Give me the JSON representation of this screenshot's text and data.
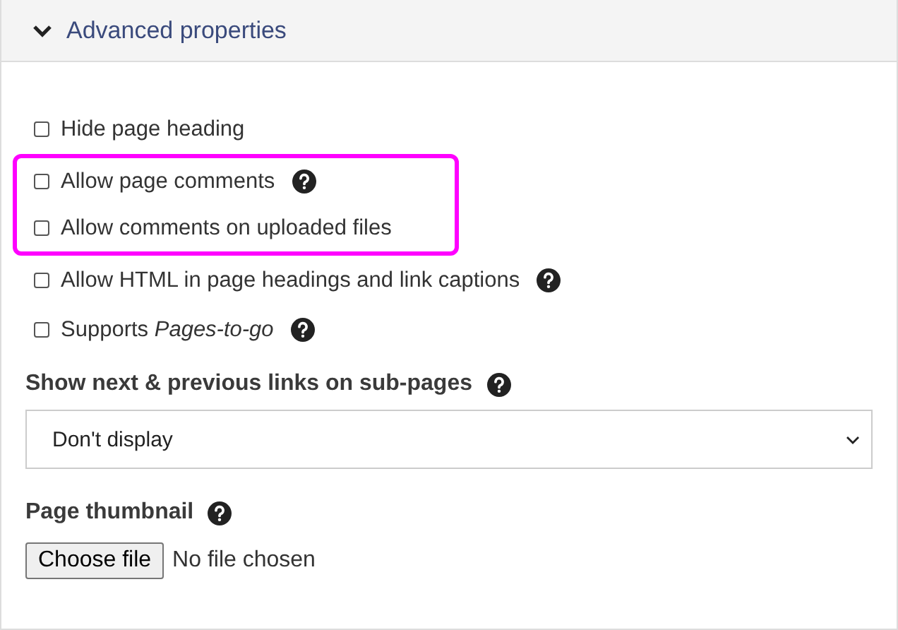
{
  "section": {
    "title": "Advanced properties",
    "expanded": true
  },
  "options": [
    {
      "label": "Hide page heading",
      "checked": false,
      "help": false,
      "highlighted": false
    },
    {
      "label": "Allow page comments",
      "checked": false,
      "help": true,
      "highlighted": true
    },
    {
      "label": "Allow comments on uploaded files",
      "checked": false,
      "help": false,
      "highlighted": true
    },
    {
      "label": "Allow HTML in page headings and link captions",
      "checked": false,
      "help": true,
      "highlighted": false
    },
    {
      "label": "Supports *Pages-to-go*",
      "checked": false,
      "help": true,
      "highlighted": false
    }
  ],
  "nav_links": {
    "label": "Show next & previous links on sub-pages",
    "help": true,
    "value": "Don't display"
  },
  "thumbnail": {
    "label": "Page thumbnail",
    "help": true,
    "button": "Choose file",
    "status": "No file chosen"
  }
}
